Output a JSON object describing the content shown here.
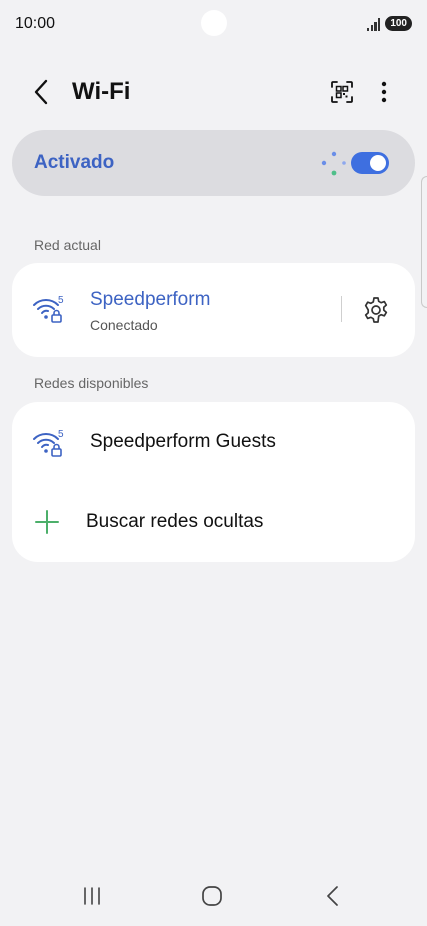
{
  "status_bar": {
    "time": "10:00",
    "battery": "100"
  },
  "header": {
    "title": "Wi-Fi",
    "back_icon": "chevron-left-icon",
    "qr_icon": "qr-code-icon",
    "more_icon": "more-vertical-icon"
  },
  "toggle": {
    "label": "Activado",
    "state": "on",
    "accent_color": "#3e6fe0"
  },
  "current_section": {
    "label": "Red actual",
    "network": {
      "name": "Speedperform",
      "status": "Conectado",
      "band": "5",
      "secured": true
    }
  },
  "available_section": {
    "label": "Redes disponibles",
    "networks": [
      {
        "name": "Speedperform Guests",
        "band": "5",
        "secured": true
      }
    ],
    "hidden_action": "Buscar redes ocultas"
  },
  "nav": {
    "recents_icon": "recents-icon",
    "home_icon": "home-icon",
    "back_icon": "back-icon"
  }
}
